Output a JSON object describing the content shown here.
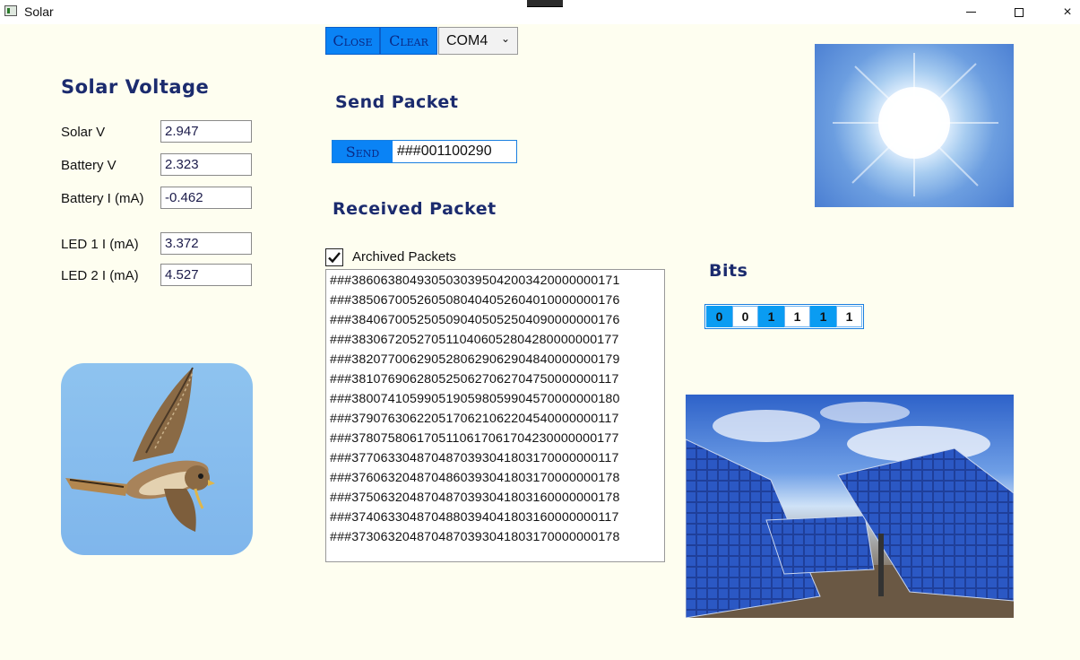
{
  "window": {
    "title": "Solar",
    "minimize_glyph": "minimize-icon",
    "maximize_glyph": "maximize-icon",
    "close_glyph": "×"
  },
  "controls": {
    "close_label": "Close",
    "clear_label": "Clear",
    "port_selected": "COM4",
    "chevron": "⌄"
  },
  "solar": {
    "heading": "Solar Voltage",
    "fields": [
      {
        "label": "Solar V",
        "value": "2.947"
      },
      {
        "label": "Battery V",
        "value": "2.323"
      },
      {
        "label": "Battery I (mA)",
        "value": "-0.462"
      },
      {
        "label": "LED 1 I (mA)",
        "value": "3.372"
      },
      {
        "label": "LED 2 I (mA)",
        "value": "4.527"
      }
    ]
  },
  "send": {
    "heading": "Send Packet",
    "button_label": "Send",
    "packet_value": "###001100290"
  },
  "received": {
    "heading": "Received Packet",
    "archive_label": "Archived Packets",
    "archive_checked": true,
    "packets": [
      "###3860638049305030395042003420000000171",
      "###3850670052605080404052604010000000176",
      "###3840670052505090405052504090000000176",
      "###3830672052705110406052804280000000177",
      "###3820770062905280629062904840000000179",
      "###3810769062805250627062704750000000117",
      "###3800741059905190598059904570000000180",
      "###3790763062205170621062204540000000117",
      "###3780758061705110617061704230000000177",
      "###3770633048704870393041803170000000117",
      "###3760632048704860393041803170000000178",
      "###3750632048704870393041803160000000178",
      "###3740633048704880394041803160000000117",
      "###3730632048704870393041803170000000178"
    ]
  },
  "bits": {
    "heading": "Bits",
    "values": [
      "0",
      "0",
      "1",
      "1",
      "1",
      "1"
    ],
    "states": [
      "on",
      "off",
      "on",
      "off",
      "on",
      "off"
    ]
  },
  "images": {
    "sun": "sun-photo",
    "bird": "falcon-photo",
    "panels": "solar-panels-photo"
  },
  "colors": {
    "background": "#fefef0",
    "accent_blue": "#0a83f5",
    "heading_navy": "#1b2b6e"
  }
}
